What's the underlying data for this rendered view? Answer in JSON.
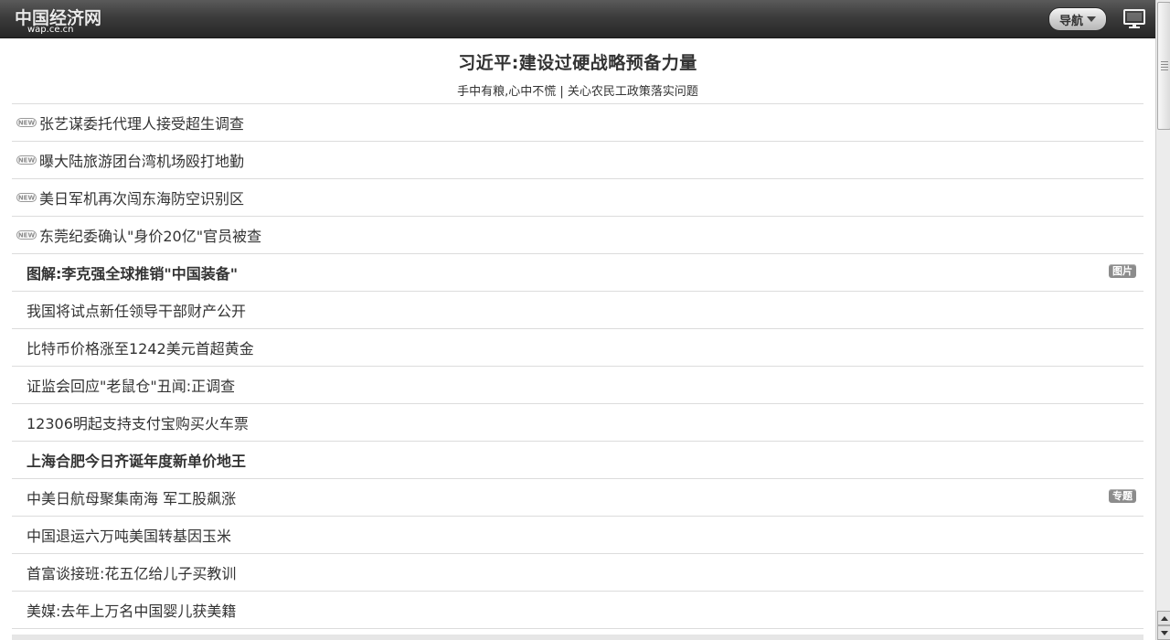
{
  "header": {
    "logo_text": "中国经济网",
    "logo_sub": "wap.ce.cn",
    "nav_label": "导航",
    "desktop_icon": "desktop-monitor-icon"
  },
  "headline": {
    "title": "习近平:建设过硬战略预备力量",
    "subtitle": "手中有粮,心中不慌 | 关心农民工政策落实问题"
  },
  "news": [
    {
      "title": "张艺谋委托代理人接受超生调查",
      "new": true,
      "bold": false,
      "tag": ""
    },
    {
      "title": "曝大陆旅游团台湾机场殴打地勤",
      "new": true,
      "bold": false,
      "tag": ""
    },
    {
      "title": "美日军机再次闯东海防空识别区",
      "new": true,
      "bold": false,
      "tag": ""
    },
    {
      "title": "东莞纪委确认\"身价20亿\"官员被查",
      "new": true,
      "bold": false,
      "tag": ""
    },
    {
      "title": "图解:李克强全球推销\"中国装备\"",
      "new": false,
      "bold": true,
      "tag": "图片"
    },
    {
      "title": "我国将试点新任领导干部财产公开",
      "new": false,
      "bold": false,
      "tag": ""
    },
    {
      "title": "比特币价格涨至1242美元首超黄金",
      "new": false,
      "bold": false,
      "tag": ""
    },
    {
      "title": "证监会回应\"老鼠仓\"丑闻:正调查",
      "new": false,
      "bold": false,
      "tag": ""
    },
    {
      "title": "12306明起支持支付宝购买火车票",
      "new": false,
      "bold": false,
      "tag": ""
    },
    {
      "title": "上海合肥今日齐诞年度新单价地王",
      "new": false,
      "bold": true,
      "tag": ""
    },
    {
      "title": "中美日航母聚集南海 军工股飙涨",
      "new": false,
      "bold": false,
      "tag": "专题"
    },
    {
      "title": "中国退运六万吨美国转基因玉米",
      "new": false,
      "bold": false,
      "tag": ""
    },
    {
      "title": "首富谈接班:花五亿给儿子买教训",
      "new": false,
      "bold": false,
      "tag": ""
    },
    {
      "title": "美媒:去年上万名中国婴儿获美籍",
      "new": false,
      "bold": false,
      "tag": ""
    }
  ],
  "new_badge_icon": "new-badge-icon"
}
